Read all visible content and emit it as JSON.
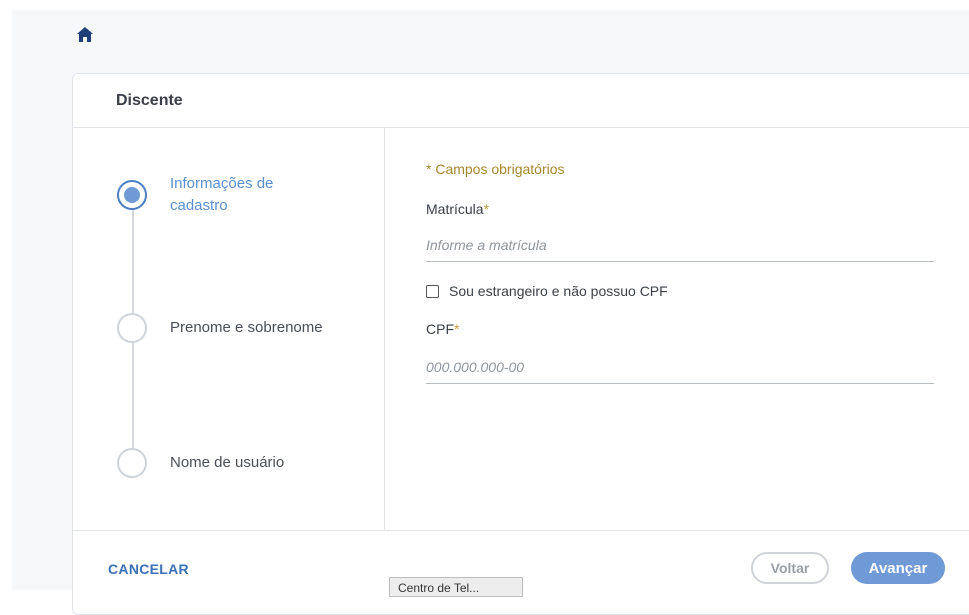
{
  "header": {
    "title": "Discente"
  },
  "nav": {
    "home_icon": "home-icon"
  },
  "steps": [
    {
      "label": "Informações de cadastro",
      "state": "active"
    },
    {
      "label": "Prenome e sobrenome",
      "state": "pending"
    },
    {
      "label": "Nome de usuário",
      "state": "pending"
    }
  ],
  "form": {
    "required_note": "* Campos obrigatórios",
    "matricula_label": "Matrícula",
    "matricula_placeholder": "Informe a matrícula",
    "foreigner_checkbox_label": "Sou estrangeiro e não possuo CPF",
    "cpf_label": "CPF",
    "cpf_placeholder": "000.000.000-00",
    "required_mark": "*"
  },
  "footer": {
    "cancel_label": "CANCELAR",
    "back_label": "Voltar",
    "next_label": "Avançar"
  },
  "tooltip": {
    "text": "Centro de Tel..."
  },
  "colors": {
    "accent": "#6f9ad6",
    "required": "#a4872c"
  }
}
